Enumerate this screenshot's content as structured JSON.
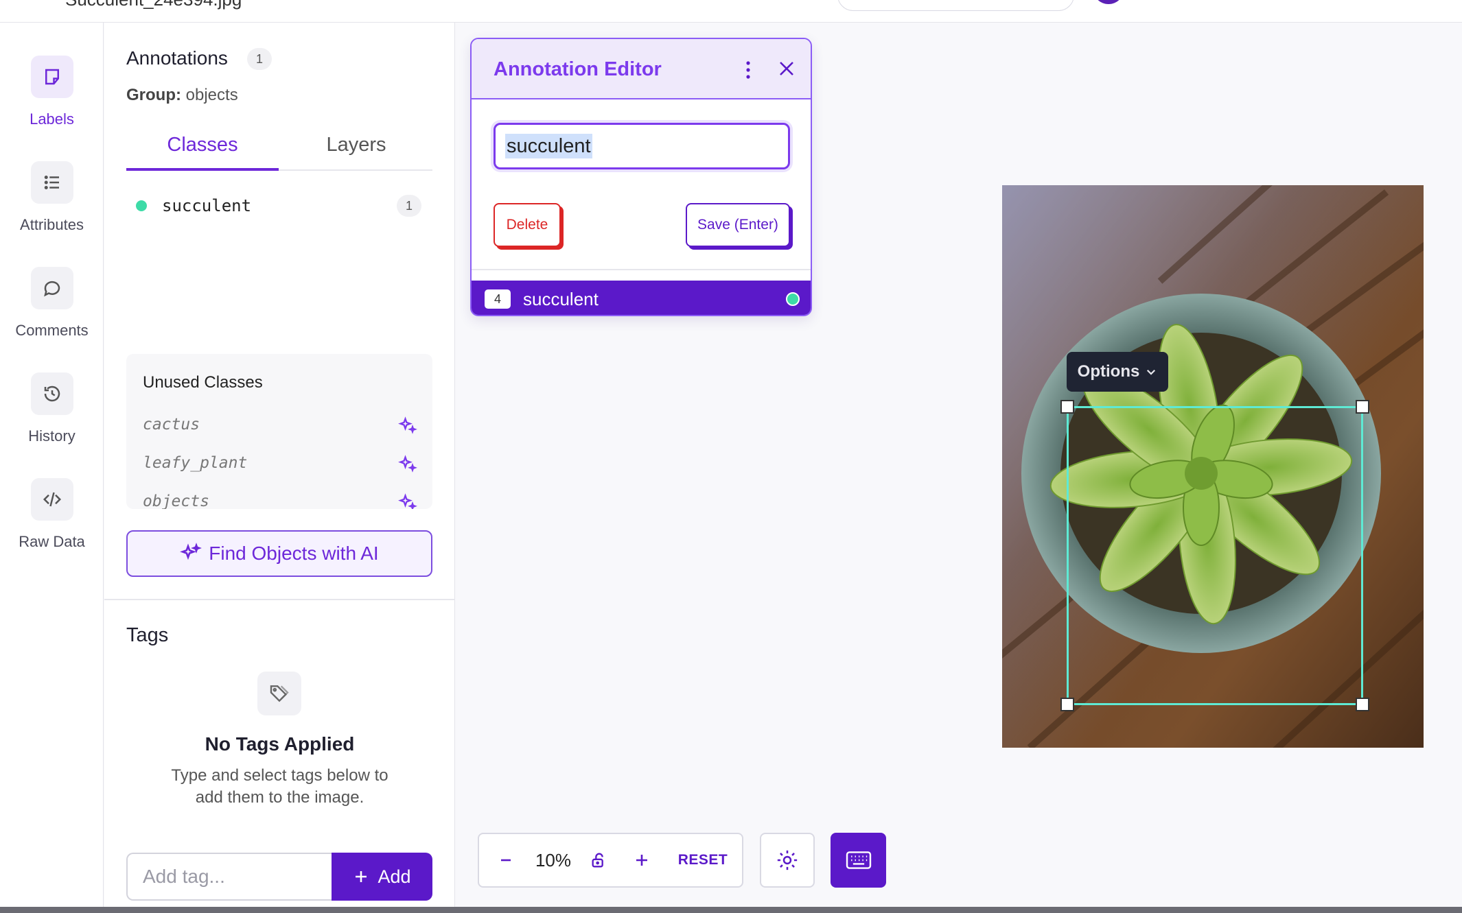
{
  "topbar": {
    "filename": "Succulent_24e394.jpg"
  },
  "rail": {
    "items": [
      {
        "label": "Labels",
        "icon": "sticky-note-icon",
        "active": true
      },
      {
        "label": "Attributes",
        "icon": "list-icon"
      },
      {
        "label": "Comments",
        "icon": "chat-bubble-icon"
      },
      {
        "label": "History",
        "icon": "history-icon"
      },
      {
        "label": "Raw Data",
        "icon": "code-icon"
      }
    ]
  },
  "panel": {
    "title": "Annotations",
    "count": "1",
    "group_label": "Group:",
    "group_value": "objects",
    "tabs": [
      {
        "label": "Classes",
        "active": true
      },
      {
        "label": "Layers"
      }
    ],
    "classes": [
      {
        "name": "succulent",
        "count": "1",
        "color": "#3ddba7"
      }
    ],
    "unused_title": "Unused Classes",
    "unused_classes": [
      "cactus",
      "leafy_plant",
      "objects"
    ],
    "ai_button": "Find Objects with AI",
    "tags_title": "Tags",
    "empty_title": "No Tags Applied",
    "empty_desc": "Type and select tags below to add them to the image.",
    "tag_placeholder": "Add tag...",
    "add_label": "Add"
  },
  "editor": {
    "title": "Annotation Editor",
    "input_value": "succulent",
    "delete_label": "Delete",
    "save_label": "Save (Enter)",
    "row_key": "4",
    "row_label": "succulent",
    "row_color": "#3ddba7"
  },
  "canvas": {
    "options_label": "Options",
    "zoom": "10%",
    "reset_label": "RESET"
  },
  "colors": {
    "accent": "#5b19c9",
    "accent_light": "#efe9fb",
    "bbox": "#5eead4",
    "danger": "#dc2626"
  }
}
